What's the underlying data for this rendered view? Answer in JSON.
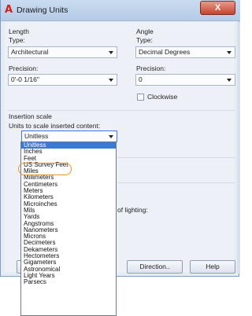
{
  "window": {
    "title": "Drawing Units",
    "close_label": "X"
  },
  "length": {
    "heading": "Length",
    "type_label": "Type:",
    "type_value": "Architectural",
    "precision_label": "Precision:",
    "precision_value": "0'-0 1/16\""
  },
  "angle": {
    "heading": "Angle",
    "type_label": "Type:",
    "type_value": "Decimal Degrees",
    "precision_label": "Precision:",
    "precision_value": "0",
    "clockwise_label": "Clockwise"
  },
  "insertion": {
    "heading": "Insertion scale",
    "sublabel": "Units to scale inserted content:",
    "value": "Unitless"
  },
  "lighting_fragment": "of lighting:",
  "buttons": {
    "direction": "Direction..",
    "help": "Help"
  },
  "dropdown_options": [
    "Unitless",
    "Inches",
    "Feet",
    "US Survey Feet",
    "Miles",
    "Millimeters",
    "Centimeters",
    "Meters",
    "Kilometers",
    "Microinches",
    "Mils",
    "Yards",
    "Angstroms",
    "Nanometers",
    "Microns",
    "Decimeters",
    "Dekameters",
    "Hectometers",
    "Gigameters",
    "Astronomical",
    "Light Years",
    "Parsecs"
  ],
  "selected_option": "Unitless",
  "highlighted_option": "US Survey Feet",
  "colors": {
    "selection": "#3b79d8",
    "highlight_ring": "#e8922a",
    "title_icon": "#d11f1f"
  }
}
